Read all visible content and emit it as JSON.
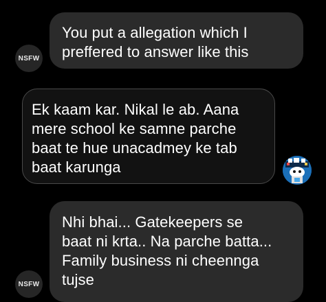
{
  "messages": [
    {
      "sender": "other",
      "avatar_label": "NSFW",
      "lines": [
        "You put a allegation which I",
        "preffered to answer like this"
      ]
    },
    {
      "sender": "self",
      "avatar_icon": "cartoon-avatar-icon",
      "lines": [
        "Ek kaam kar. Nikal le ab. Aana",
        "mere school ke samne parche",
        "baat te hue unacadmey ke tab",
        "baat karunga"
      ]
    },
    {
      "sender": "other",
      "avatar_label": "NSFW",
      "lines": [
        "Nhi bhai... Gatekeepers se",
        "baat ni krta.. Na parche batta...",
        "Family business ni cheennga",
        "tujse"
      ]
    }
  ],
  "colors": {
    "background": "#000000",
    "incoming_bubble": "#2b2b2b",
    "outgoing_bubble": "#121212",
    "outgoing_border": "#4a4a4a",
    "text": "#ffffff",
    "avatar_bg": "#262626",
    "self_avatar_bg": "#1b6fb8"
  }
}
